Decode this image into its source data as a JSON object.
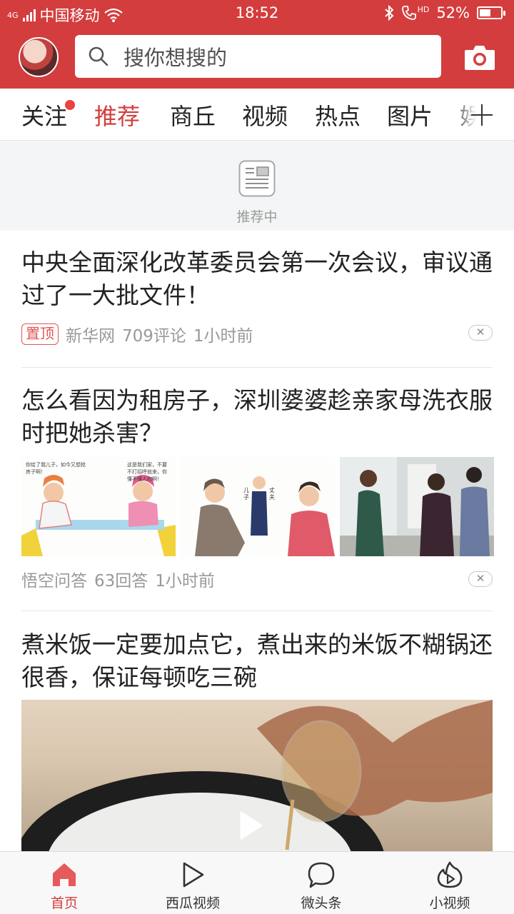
{
  "status_bar": {
    "network": "4G",
    "carrier": "中国移动",
    "time": "18:52",
    "hd_label": "HD",
    "battery_text": "52%",
    "battery_level": 0.52
  },
  "header": {
    "search_placeholder": "搜你想搜的",
    "accent_color": "#d43d3d"
  },
  "tabs": [
    {
      "label": "关注",
      "has_dot": true
    },
    {
      "label": "推荐",
      "active": true
    },
    {
      "label": "商丘"
    },
    {
      "label": "视频"
    },
    {
      "label": "热点"
    },
    {
      "label": "图片"
    },
    {
      "label": "娱"
    }
  ],
  "loading": {
    "label": "推荐中"
  },
  "feed": [
    {
      "title": "中央全面深化改革委员会第一次会议，审议通过了一大批文件！",
      "badge": "置顶",
      "source": "新华网",
      "comments": "709评论",
      "time": "1小时前"
    },
    {
      "title": "怎么看因为租房子，深圳婆婆趁亲家母洗衣服时把她杀害？",
      "source": "悟空问答",
      "comments": "63回答",
      "time": "1小时前",
      "thumb_texts": {
        "bubble_1": "你给了我儿子，如今又想抢房子啊！",
        "bubble_2": "这是我们家，不要不打招呼就来，你懂不懂人权啊！",
        "label_son": "儿子",
        "label_husband": "丈夫"
      }
    },
    {
      "title": "煮米饭一定要加点它，煮出来的米饭不糊锅还很香，保证每顿吃三碗",
      "type": "video"
    }
  ],
  "bottom_nav": [
    {
      "label": "首页",
      "icon": "home-icon",
      "active": true
    },
    {
      "label": "西瓜视频",
      "icon": "play-outline-icon"
    },
    {
      "label": "微头条",
      "icon": "chat-bubble-icon"
    },
    {
      "label": "小视频",
      "icon": "flame-play-icon"
    }
  ]
}
